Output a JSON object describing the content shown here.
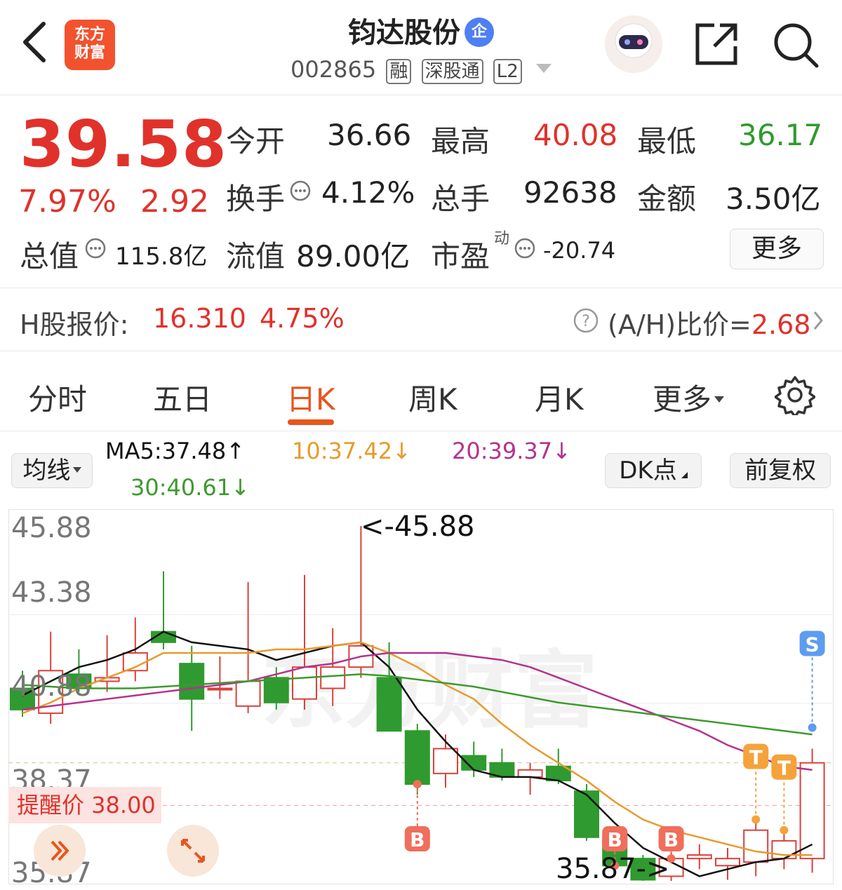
{
  "header": {
    "brand_lines": [
      "东方",
      "财富"
    ],
    "title": "钧达股份",
    "title_badge": "企",
    "code": "002865",
    "tags": [
      "融",
      "深股通",
      "L2"
    ]
  },
  "quote": {
    "price": "39.58",
    "change_pct": "7.97%",
    "change": "2.92",
    "open_label": "今开",
    "open": "36.66",
    "high_label": "最高",
    "high": "40.08",
    "low_label": "最低",
    "low": "36.17",
    "turnover_label": "换手",
    "turnover": "4.12%",
    "volume_label": "总手",
    "volume": "92638",
    "amount_label": "金额",
    "amount": "3.50亿",
    "mcap_label": "总值",
    "mcap": "115.8亿",
    "float_label": "流值",
    "float_mcap": "89.00亿",
    "pe_label": "市盈",
    "pe_sup": "动",
    "pe": "-20.74",
    "more": "更多"
  },
  "hshare": {
    "label": "H股报价:",
    "price": "16.310",
    "pct": "4.75%",
    "ratio_label": "(A/H)比价=",
    "ratio": "2.68"
  },
  "tabs": [
    "分时",
    "五日",
    "日K",
    "周K",
    "月K",
    "更多"
  ],
  "active_tab": "日K",
  "indicators": {
    "ma_button": "均线",
    "ma5": "MA5:37.48",
    "ma10": "10:37.42",
    "ma20": "20:39.37",
    "ma30": "30:40.61",
    "dk_button": "DK点",
    "adjust_button": "前复权"
  },
  "chart_data": {
    "type": "candlestick",
    "y_ticks": [
      "45.88",
      "43.38",
      "40.88",
      "38.37",
      "35.87"
    ],
    "ylim": [
      35.87,
      45.88
    ],
    "max_label": "<-45.88",
    "min_label": "35.87->",
    "remind_label": "提醒价 38.00",
    "watermark": "东方财富",
    "candles": [
      {
        "o": 41.3,
        "c": 40.7,
        "h": 41.8,
        "l": 40.5
      },
      {
        "o": 40.6,
        "c": 41.8,
        "h": 42.9,
        "l": 40.3
      },
      {
        "o": 41.7,
        "c": 41.3,
        "h": 42.4,
        "l": 41.2
      },
      {
        "o": 41.5,
        "c": 41.6,
        "h": 42.8,
        "l": 41.2
      },
      {
        "o": 41.8,
        "c": 42.3,
        "h": 43.3,
        "l": 41.5
      },
      {
        "o": 42.9,
        "c": 42.6,
        "h": 44.6,
        "l": 42.4
      },
      {
        "o": 42.0,
        "c": 41.0,
        "h": 42.5,
        "l": 40.1
      },
      {
        "o": 41.3,
        "c": 41.3,
        "h": 42.2,
        "l": 41.0
      },
      {
        "o": 40.8,
        "c": 41.5,
        "h": 44.3,
        "l": 40.6
      },
      {
        "o": 41.6,
        "c": 40.9,
        "h": 41.9,
        "l": 40.7
      },
      {
        "o": 41.0,
        "c": 41.9,
        "h": 44.5,
        "l": 40.7
      },
      {
        "o": 41.3,
        "c": 41.9,
        "h": 43.0,
        "l": 40.8
      },
      {
        "o": 41.9,
        "c": 42.5,
        "h": 45.88,
        "l": 41.6
      },
      {
        "o": 41.6,
        "c": 40.1,
        "h": 42.6,
        "l": 40.1
      },
      {
        "o": 40.1,
        "c": 38.6,
        "h": 40.3,
        "l": 38.3
      },
      {
        "o": 38.9,
        "c": 39.6,
        "h": 40.0,
        "l": 38.5
      },
      {
        "o": 39.4,
        "c": 39.0,
        "h": 39.8,
        "l": 38.8
      },
      {
        "o": 39.2,
        "c": 38.8,
        "h": 39.6,
        "l": 38.7
      },
      {
        "o": 38.8,
        "c": 39.0,
        "h": 39.2,
        "l": 38.3
      },
      {
        "o": 39.1,
        "c": 38.7,
        "h": 39.6,
        "l": 38.6
      },
      {
        "o": 38.4,
        "c": 37.1,
        "h": 38.6,
        "l": 37.0
      },
      {
        "o": 37.1,
        "c": 36.3,
        "h": 37.3,
        "l": 36.2
      },
      {
        "o": 36.5,
        "c": 35.9,
        "h": 36.6,
        "l": 35.87
      },
      {
        "o": 36.0,
        "c": 36.5,
        "h": 36.8,
        "l": 35.87
      },
      {
        "o": 36.5,
        "c": 36.6,
        "h": 36.9,
        "l": 36.2
      },
      {
        "o": 36.3,
        "c": 36.5,
        "h": 36.8,
        "l": 35.9
      },
      {
        "o": 36.4,
        "c": 37.3,
        "h": 37.6,
        "l": 36.0
      },
      {
        "o": 36.5,
        "c": 37.0,
        "h": 37.3,
        "l": 36.2
      },
      {
        "o": 36.5,
        "c": 39.2,
        "h": 39.6,
        "l": 36.1
      }
    ],
    "series": [
      {
        "name": "MA5",
        "color": "#111111",
        "values": [
          41.1,
          41.5,
          41.9,
          42.1,
          42.4,
          42.9,
          42.6,
          42.5,
          42.4,
          42.1,
          42.3,
          42.5,
          42.6,
          41.9,
          40.7,
          39.8,
          39.0,
          38.8,
          38.8,
          38.7,
          38.3,
          37.5,
          36.8,
          36.4,
          36.0,
          36.2,
          36.4,
          36.5,
          36.9
        ]
      },
      {
        "name": "10",
        "color": "#e89a2c",
        "values": [
          40.6,
          40.9,
          41.3,
          41.6,
          41.9,
          42.3,
          42.3,
          42.3,
          42.3,
          42.4,
          42.4,
          42.5,
          42.6,
          42.3,
          41.9,
          41.4,
          41.0,
          40.3,
          39.7,
          39.2,
          38.7,
          38.1,
          37.6,
          37.3,
          37.1,
          36.9,
          36.7,
          36.6,
          36.6
        ]
      },
      {
        "name": "20",
        "color": "#b3338f",
        "values": [
          40.7,
          40.8,
          40.9,
          41.0,
          41.1,
          41.2,
          41.3,
          41.4,
          41.5,
          41.7,
          41.9,
          42.0,
          42.2,
          42.3,
          42.3,
          42.3,
          42.2,
          42.1,
          41.9,
          41.6,
          41.3,
          41.0,
          40.7,
          40.4,
          40.1,
          39.7,
          39.4,
          39.1,
          39.0
        ]
      },
      {
        "name": "30",
        "color": "#3d9a2e",
        "values": [
          41.4,
          41.35,
          41.3,
          41.3,
          41.3,
          41.35,
          41.4,
          41.45,
          41.5,
          41.55,
          41.6,
          41.65,
          41.7,
          41.65,
          41.55,
          41.45,
          41.35,
          41.2,
          41.05,
          40.9,
          40.8,
          40.7,
          40.6,
          40.5,
          40.4,
          40.3,
          40.2,
          40.1,
          40.0
        ]
      }
    ],
    "markers": [
      {
        "i": 14,
        "label": "B",
        "color": "#f06e5c"
      },
      {
        "i": 21,
        "label": "B",
        "color": "#f06e5c"
      },
      {
        "i": 23,
        "label": "B",
        "color": "#f06e5c"
      },
      {
        "i": 26,
        "label": "T",
        "color": "#f5a23b"
      },
      {
        "i": 27,
        "label": "T",
        "color": "#f5a23b"
      },
      {
        "i": 28,
        "label": "S",
        "color": "#5d9cf0"
      }
    ]
  }
}
